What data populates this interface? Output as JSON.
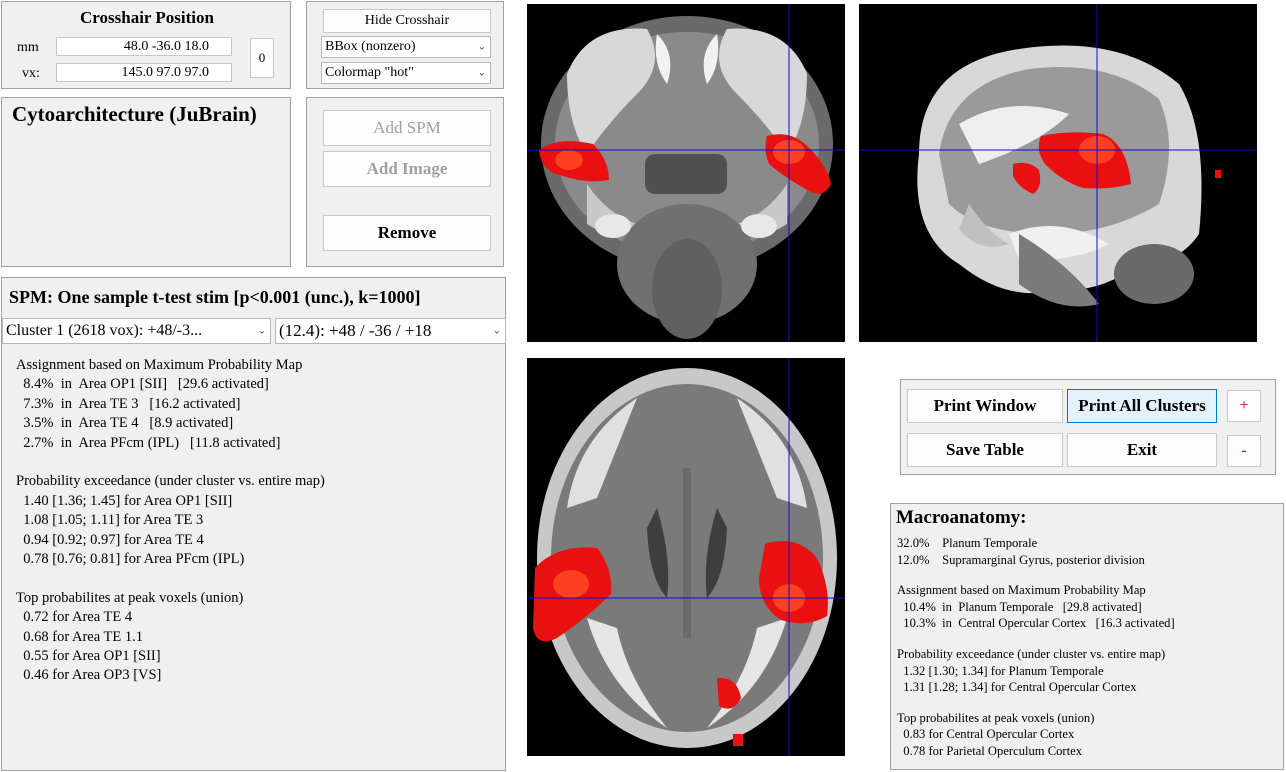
{
  "crosshair": {
    "title": "Crosshair Position",
    "mm_label": "mm",
    "vx_label": "vx:",
    "mm_value": "48.0   -36.0    18.0",
    "vx_value": "145.0    97.0    97.0",
    "zero_button": "0"
  },
  "controls": {
    "hide_crosshair": "Hide Crosshair",
    "bbox_select": "BBox (nonzero)",
    "colormap_select": "Colormap \"hot\""
  },
  "atlas": {
    "title": "Cytoarchitecture (JuBrain)",
    "add_spm": "Add SPM",
    "add_image": "Add Image",
    "remove": "Remove"
  },
  "spm": {
    "title": "SPM: One sample t-test stim [p<0.001 (unc.), k=1000]",
    "cluster_select": "Cluster 1 (2618 vox): +48/-3...",
    "peak_select": "(12.4):  +48 / -36 / +18"
  },
  "results": {
    "assign_heading": "Assignment based on Maximum Probability Map",
    "assign_rows": [
      "  8.4%  in  Area OP1 [SII]   [29.6 activated]",
      "  7.3%  in  Area TE 3   [16.2 activated]",
      "  3.5%  in  Area TE 4   [8.9 activated]",
      "  2.7%  in  Area PFcm (IPL)   [11.8 activated]"
    ],
    "exceed_heading": "Probability exceedance (under cluster vs. entire map)",
    "exceed_rows": [
      "  1.40 [1.36; 1.45] for Area OP1 [SII]",
      "  1.08 [1.05; 1.11] for Area TE 3",
      "  0.94 [0.92; 0.97] for Area TE 4",
      "  0.78 [0.76; 0.81] for Area PFcm (IPL)"
    ],
    "peak_heading": "Top probabilites at peak voxels (union)",
    "peak_rows": [
      "  0.72 for Area TE 4",
      "  0.68 for Area TE 1.1",
      "  0.55 for Area OP1 [SII]",
      "  0.46 for Area OP3 [VS]"
    ]
  },
  "actions": {
    "print_window": "Print Window",
    "print_all": "Print All Clusters",
    "save_table": "Save Table",
    "exit": "Exit",
    "plus": "+",
    "minus": "-"
  },
  "macro": {
    "title": "Macroanatomy:",
    "top_rows": [
      "32.0%    Planum Temporale",
      "12.0%    Supramarginal Gyrus, posterior division"
    ],
    "assign_heading": "Assignment based on Maximum Probability Map",
    "assign_rows": [
      "  10.4%  in  Planum Temporale   [29.8 activated]",
      "  10.3%  in  Central Opercular Cortex   [16.3 activated]"
    ],
    "exceed_heading": "Probability exceedance (under cluster vs. entire map)",
    "exceed_rows": [
      "  1.32 [1.30; 1.34] for Planum Temporale",
      "  1.31 [1.28; 1.34] for Central Opercular Cortex"
    ],
    "peak_heading": "Top probabilites at peak voxels (union)",
    "peak_rows": [
      "  0.83 for Central Opercular Cortex",
      "  0.78 for Parietal Operculum Cortex"
    ]
  },
  "colors": {
    "crosshair": "#1010c0",
    "activation": "#e81010",
    "activation_peak": "#ff4020",
    "minus_plus": "#c00000"
  }
}
